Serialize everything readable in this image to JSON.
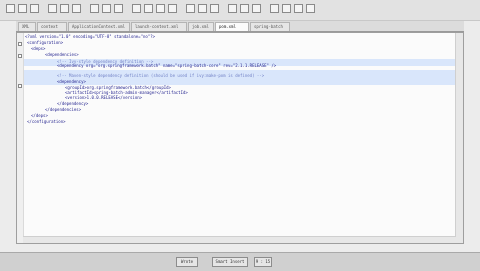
{
  "editor": {
    "tabs": [
      {
        "label": "XML"
      },
      {
        "label": "context"
      },
      {
        "label": "ApplicationContext.xml"
      },
      {
        "label": "launch-context.xml"
      },
      {
        "label": "job.xml"
      },
      {
        "label": "pom.xml"
      },
      {
        "label": "spring-batch"
      }
    ],
    "lines": [
      "<?xml version=\"1.0\" encoding=\"UTF-8\" standalone=\"no\"?>",
      "<configuration>",
      "<deps>",
      "<dependencies>",
      "<!-- Ivy-style dependency definition -->",
      "<dependency org=\"org.springframework.batch\" name=\"spring-batch-core\" rev=\"2.1.1.RELEASE\" />",
      "<!-- Maven-style dependency definition (should be used if ivy:make-pom is defined) -->",
      "<dependency>",
      "<groupId>org.springframework.batch</groupId>",
      "<artifactId>spring-batch-admin-manager</artifactId>",
      "<version>1.0.0.RELEASE</version>",
      "</dependency>",
      "</dependencies>",
      "</deps>",
      "</configuration>"
    ]
  },
  "taskbar": {
    "buttons": [
      {
        "label": "Wrote"
      },
      {
        "label": "Smart Insert"
      },
      {
        "label": "9 : 15"
      }
    ]
  }
}
